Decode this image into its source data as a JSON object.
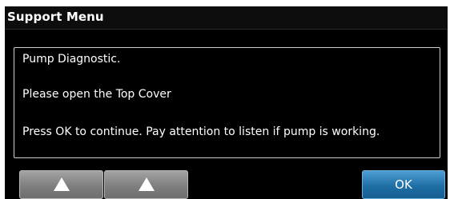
{
  "window": {
    "title": "Support Menu"
  },
  "message": {
    "lines": [
      "Pump Diagnostic.",
      "Please open the Top Cover",
      "Press OK to continue. Pay attention to listen if pump is working."
    ]
  },
  "buttons": {
    "up_left_icon": "up-triangle-icon",
    "up_right_icon": "up-triangle-icon",
    "ok_label": "OK"
  },
  "colors": {
    "background": "#000000",
    "text": "#ffffff",
    "ok_button": "#1f6fa6",
    "arrow_button": "#7f7f7f"
  }
}
